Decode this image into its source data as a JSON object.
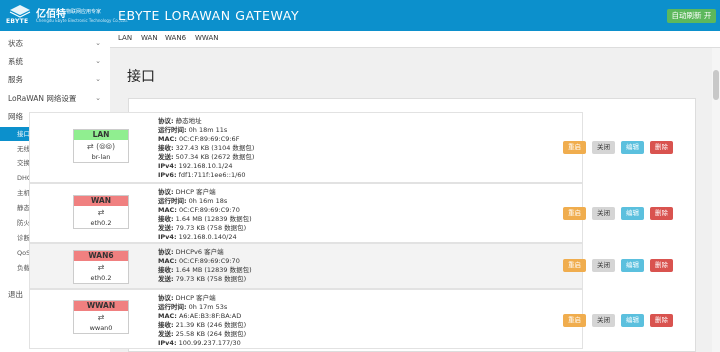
{
  "header": {
    "logo_cn": "亿佰特",
    "logo_brand": "EBYTE",
    "logo_tag": "物联网应用专家",
    "logo_sub": "Chengdu Ebyte Electronic Technology Co.,Ltd.",
    "title": "EBYTE LORAWAN GATEWAY",
    "refresh_label": "自动刷新 开",
    "accent": "#0c90cc"
  },
  "sidebar": {
    "items": [
      {
        "label": "状态",
        "icon": "chevron-down-icon"
      },
      {
        "label": "系统",
        "icon": "chevron-down-icon"
      },
      {
        "label": "服务",
        "icon": "chevron-down-icon"
      },
      {
        "label": "LoRaWAN 网络设置",
        "icon": "chevron-down-icon"
      },
      {
        "label": "网络",
        "icon": "chevron-up-icon"
      }
    ],
    "subitems": [
      "接口",
      "无线",
      "交换机",
      "DHCP/DNS",
      "主机名",
      "静态路由",
      "防火墙",
      "诊断",
      "QoS",
      "负载均衡"
    ],
    "active_subitem": "接口",
    "exit": "退出"
  },
  "tabs": [
    "LAN",
    "WAN",
    "WAN6",
    "WWAN"
  ],
  "page_title": "接口",
  "buttons": {
    "restart": "重启",
    "stop": "关闭",
    "edit": "编辑",
    "delete": "删除"
  },
  "interfaces": [
    {
      "name": "LAN",
      "label_color": "#90ee90",
      "device": "br-lan",
      "icons": "⇄ (⦾⦾)",
      "lines": [
        {
          "k": "协议:",
          "v": " 静态地址"
        },
        {
          "k": "运行时间:",
          "v": " 0h 18m 11s"
        },
        {
          "k": "MAC:",
          "v": " 0C:CF:89:69:C9:6F"
        },
        {
          "k": "接收:",
          "v": " 327.43 KB (3104 数据包)"
        },
        {
          "k": "发送:",
          "v": " 507.34 KB (2672 数据包)"
        },
        {
          "k": "IPv4:",
          "v": " 192.168.10.1/24"
        },
        {
          "k": "IPv6:",
          "v": " fdf1:711f:1ee6::1/60"
        }
      ]
    },
    {
      "name": "WAN",
      "label_color": "#f08080",
      "device": "eth0.2",
      "icons": "⇄",
      "lines": [
        {
          "k": "协议:",
          "v": " DHCP 客户端"
        },
        {
          "k": "运行时间:",
          "v": " 0h 16m 18s"
        },
        {
          "k": "MAC:",
          "v": " 0C:CF:89:69:C9:70"
        },
        {
          "k": "接收:",
          "v": " 1.64 MB (12839 数据包)"
        },
        {
          "k": "发送:",
          "v": " 79.73 KB (758 数据包)"
        },
        {
          "k": "IPv4:",
          "v": " 192.168.0.140/24"
        }
      ]
    },
    {
      "name": "WAN6",
      "label_color": "#f08080",
      "device": "eth0.2",
      "icons": "⇄",
      "lines": [
        {
          "k": "协议:",
          "v": " DHCPv6 客户端"
        },
        {
          "k": "MAC:",
          "v": " 0C:CF:89:69:C9:70"
        },
        {
          "k": "接收:",
          "v": " 1.64 MB (12839 数据包)"
        },
        {
          "k": "发送:",
          "v": " 79.73 KB (758 数据包)"
        }
      ]
    },
    {
      "name": "WWAN",
      "label_color": "#f08080",
      "device": "wwan0",
      "icons": "⇄",
      "lines": [
        {
          "k": "协议:",
          "v": " DHCP 客户端"
        },
        {
          "k": "运行时间:",
          "v": " 0h 17m 53s"
        },
        {
          "k": "MAC:",
          "v": " A6:AE:B3:8F:BA:AD"
        },
        {
          "k": "接收:",
          "v": " 21.39 KB (246 数据包)"
        },
        {
          "k": "发送:",
          "v": " 25.58 KB (264 数据包)"
        },
        {
          "k": "IPv4:",
          "v": " 100.99.237.177/30"
        }
      ]
    }
  ]
}
